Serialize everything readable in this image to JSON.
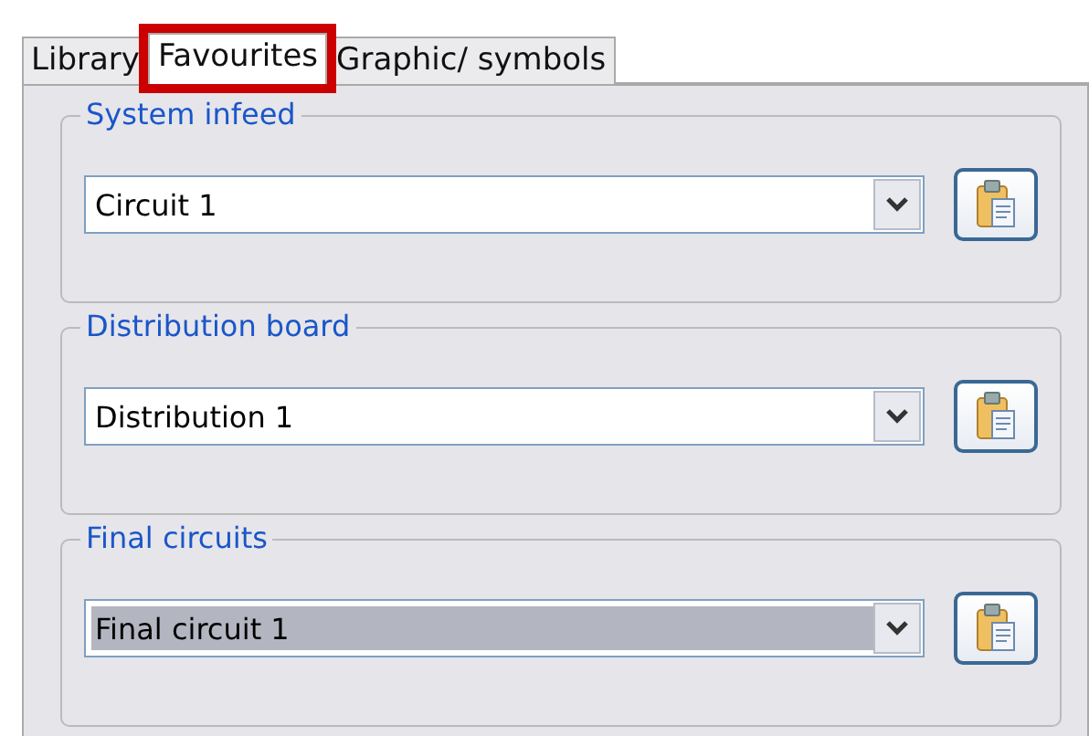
{
  "tabs": [
    {
      "label": "Library",
      "selected": false,
      "highlighted": false
    },
    {
      "label": "Favourites",
      "selected": true,
      "highlighted": true
    },
    {
      "label": "Graphic/ symbols",
      "selected": false,
      "highlighted": false
    }
  ],
  "groups": [
    {
      "title": "System infeed",
      "value": "Circuit 1",
      "focused": false
    },
    {
      "title": "Distribution board",
      "value": "Distribution 1",
      "focused": false
    },
    {
      "title": "Final circuits",
      "value": "Final circuit 1",
      "focused": true
    }
  ]
}
